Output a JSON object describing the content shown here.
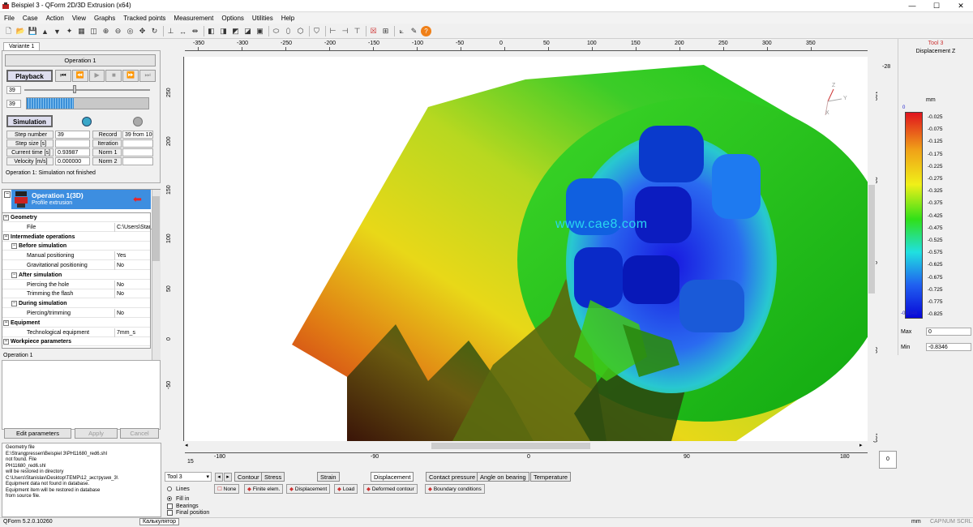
{
  "window": {
    "title": "Beispiel 3 - QForm 2D/3D Extrusion (x64)",
    "min": "—",
    "max": "☐",
    "close": "✕"
  },
  "menu": [
    "File",
    "Case",
    "Action",
    "View",
    "Graphs",
    "Tracked points",
    "Measurement",
    "Options",
    "Utilities",
    "Help"
  ],
  "toolbar_icons": [
    "new-icon",
    "open-icon",
    "save-icon",
    "press-icon",
    "press2-icon",
    "tool-icon",
    "grid-icon",
    "fit-icon",
    "zoom-in-icon",
    "zoom-out-icon",
    "zoom-icon",
    "move-icon",
    "rotate-icon",
    "sep",
    "cut-icon",
    "measure-icon",
    "measure2-icon",
    "sep",
    "view1-icon",
    "view2-icon",
    "view3-icon",
    "view4-icon",
    "view5-icon",
    "sep",
    "ellipse-icon",
    "ellipse2-icon",
    "cube-icon",
    "sep",
    "shield-icon",
    "sep",
    "ruler-icon",
    "ruler2-icon",
    "ruler3-icon",
    "sep",
    "cross-icon",
    "grid2-icon",
    "sep",
    "axis-icon",
    "wand-icon",
    "help-icon"
  ],
  "left": {
    "tab": "Variante 1",
    "operation_button": "Operation 1",
    "playback_label": "Playback",
    "playback_step": "39",
    "simulation_step": "39",
    "simulation_label": "Simulation",
    "fields": [
      {
        "label": "Step number",
        "value": "39",
        "label2": "Record",
        "value2": "39 from 100"
      },
      {
        "label": "Step size [s]",
        "value": "",
        "label2": "Iteration",
        "value2": ""
      },
      {
        "label": "Current time [s]",
        "value": "0.93987",
        "label2": "Norm 1",
        "value2": ""
      },
      {
        "label": "Velocity [m/s]",
        "value": "0.000000",
        "label2": "Norm 2",
        "value2": ""
      }
    ],
    "status": "Operation 1: Simulation not finished",
    "op_title": "Operation 1(3D)",
    "op_sub": "Profile extrusion",
    "tree": [
      {
        "type": "h",
        "label": "Geometry",
        "value": ""
      },
      {
        "type": "r",
        "label": "File",
        "value": "C:\\Users\\Stani"
      },
      {
        "type": "h",
        "label": "Intermediate operations",
        "value": ""
      },
      {
        "type": "h2",
        "label": "Before simulation",
        "value": ""
      },
      {
        "type": "r",
        "label": "Manual positioning",
        "value": "Yes"
      },
      {
        "type": "r",
        "label": "Gravitational positioning",
        "value": "No"
      },
      {
        "type": "h2",
        "label": "After simulation",
        "value": ""
      },
      {
        "type": "r",
        "label": "Piercing the hole",
        "value": "No"
      },
      {
        "type": "r",
        "label": "Trimming the flash",
        "value": "No"
      },
      {
        "type": "h2",
        "label": "During simulation",
        "value": ""
      },
      {
        "type": "r",
        "label": "Piercing/trimming",
        "value": "No"
      },
      {
        "type": "h",
        "label": "Equipment",
        "value": ""
      },
      {
        "type": "r",
        "label": "Technological equipment",
        "value": "7mm_s"
      },
      {
        "type": "h",
        "label": "Workpiece parameters",
        "value": ""
      }
    ],
    "footer_label": "Operation 1",
    "edit_button": "Edit parameters",
    "apply_button": "Apply",
    "cancel_button": "Cancel",
    "log": [
      "Geometry file",
      "E:\\Strangpressen\\Beispiel 3\\PH11680_red6.shl",
      "not found. File",
      "PH11680_red6.shl",
      "will be restored in directory",
      "C:\\Users\\Stanislav\\Desktop\\TEMP\\12_экструзия_3\\",
      "Equipment data not found in database.",
      "Equipment item will be restored in database",
      "from source file."
    ]
  },
  "rulers": {
    "top": [
      "-350",
      "-300",
      "-250",
      "-200",
      "-150",
      "-100",
      "-50",
      "0",
      "50",
      "100",
      "150",
      "200",
      "250",
      "300",
      "350"
    ],
    "left": [
      "250",
      "200",
      "150",
      "100",
      "50",
      "0",
      "-50"
    ],
    "right": [
      "-180",
      "-90",
      "0",
      "90",
      "180"
    ],
    "bottom": [
      "-180",
      "-90",
      "0",
      "90",
      "180"
    ],
    "left_bottom": "15",
    "right_top": "-28"
  },
  "watermark": "www.cae8.com",
  "axes": {
    "z": "Z",
    "y": "Y",
    "x": "X"
  },
  "legend": {
    "tool": "Tool 3",
    "field": "Displacement Z",
    "unit": "mm",
    "top_value": "0",
    "bottom_value": "-0.8346",
    "values": [
      "-0.025",
      "-0.075",
      "-0.125",
      "-0.175",
      "-0.225",
      "-0.275",
      "-0.325",
      "-0.375",
      "-0.425",
      "-0.475",
      "-0.525",
      "-0.575",
      "-0.625",
      "-0.675",
      "-0.725",
      "-0.775",
      "-0.825"
    ],
    "max_label": "Max",
    "max_value": "0",
    "min_label": "Min",
    "min_value": "-0.8346"
  },
  "bottom": {
    "tool_select": "Tool 3",
    "tabs": [
      "Contour",
      "Stress",
      "Strain",
      "Displacement",
      "Contact pressure",
      "Angle on bearing",
      "Temperature"
    ],
    "modes": [
      "None",
      "Finite elem.",
      "Displacement",
      "Load",
      "Deformed contour",
      "Boundary conditions"
    ],
    "radios": [
      "Lines",
      "Fill in"
    ],
    "checks": [
      "Bearings",
      "Final position"
    ],
    "corner": "0"
  },
  "status": {
    "left": "QForm 5.2.0.10260",
    "taskbar": "Калькулятор",
    "unit": "mm",
    "cap": "CAP",
    "num": "NUM",
    "scrl": "SCRL"
  }
}
